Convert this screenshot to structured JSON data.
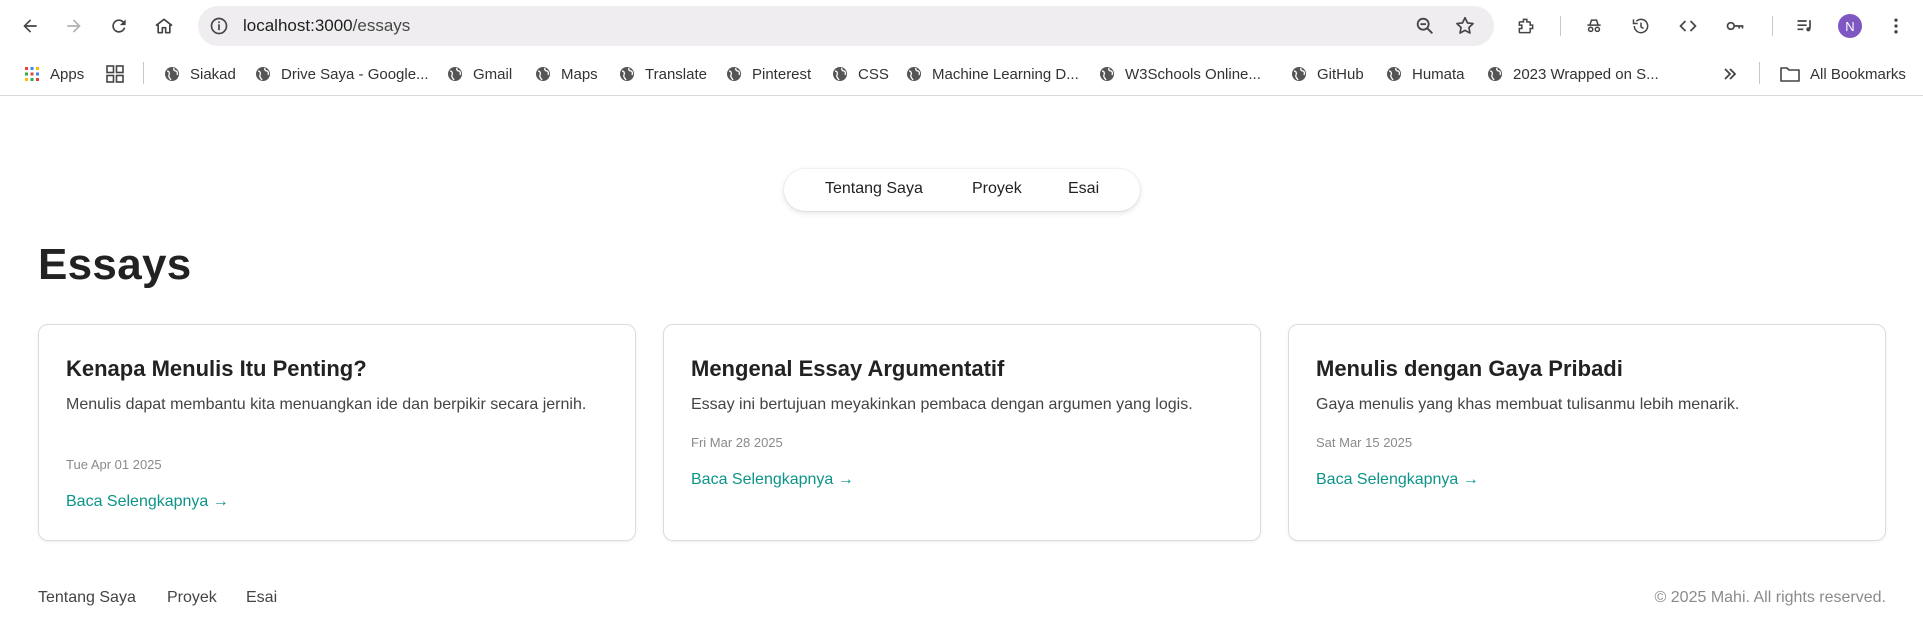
{
  "browser": {
    "url_host": "localhost:3000",
    "url_path": "/essays",
    "avatar_letter": "N",
    "bookmarks": [
      {
        "label": "Apps"
      },
      {
        "label": "Siakad"
      },
      {
        "label": "Drive Saya - Google..."
      },
      {
        "label": "Gmail"
      },
      {
        "label": "Maps"
      },
      {
        "label": "Translate"
      },
      {
        "label": "Pinterest"
      },
      {
        "label": "CSS"
      },
      {
        "label": "Machine Learning D..."
      },
      {
        "label": "W3Schools Online..."
      },
      {
        "label": "GitHub"
      },
      {
        "label": "Humata"
      },
      {
        "label": "2023 Wrapped on S..."
      }
    ],
    "all_bookmarks": "All Bookmarks",
    "avatar_color": "#7e57c2"
  },
  "nav": {
    "items": [
      "Tentang Saya",
      "Proyek",
      "Esai"
    ]
  },
  "page": {
    "title": "Essays"
  },
  "essays": [
    {
      "title": "Kenapa Menulis Itu Penting?",
      "excerpt": "Menulis dapat membantu kita menuangkan ide dan berpikir secara jernih.",
      "date": "Tue Apr 01 2025",
      "link": "Baca Selengkapnya →"
    },
    {
      "title": "Mengenal Essay Argumentatif",
      "excerpt": "Essay ini bertujuan meyakinkan pembaca dengan argumen yang logis.",
      "date": "Fri Mar 28 2025",
      "link": "Baca Selengkapnya →"
    },
    {
      "title": "Menulis dengan Gaya Pribadi",
      "excerpt": "Gaya menulis yang khas membuat tulisanmu lebih menarik.",
      "date": "Sat Mar 15 2025",
      "link": "Baca Selengkapnya →"
    }
  ],
  "footer": {
    "links": [
      "Tentang Saya",
      "Proyek",
      "Esai"
    ],
    "copyright": "© 2025 Mahi. All rights reserved."
  },
  "colors": {
    "accent": "#0d9488"
  }
}
